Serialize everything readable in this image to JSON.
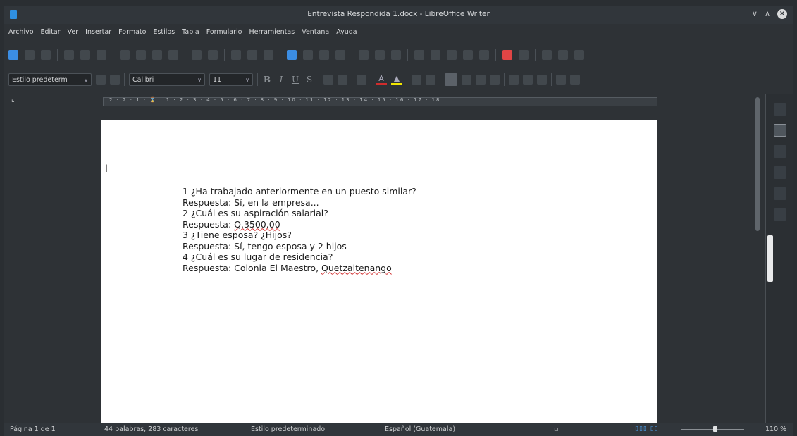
{
  "window": {
    "title": "Entrevista Respondida 1.docx - LibreOffice Writer"
  },
  "menu": [
    "Archivo",
    "Editar",
    "Ver",
    "Insertar",
    "Formato",
    "Estilos",
    "Tabla",
    "Formulario",
    "Herramientas",
    "Ventana",
    "Ayuda"
  ],
  "formatting": {
    "paragraph_style": "Estilo predeterm",
    "font_name": "Calibri",
    "font_size": "11"
  },
  "document": {
    "lines": [
      "1 ¿Ha trabajado anteriormente en un puesto similar?",
      "Respuesta: Sí, en la empresa...",
      "2 ¿Cuál es su aspiración salarial?",
      "Respuesta: Q.3500.00",
      "3 ¿Tiene esposa? ¿Hijos?",
      "Respuesta: Sí, tengo esposa y 2 hijos",
      "4 ¿Cuál es su lugar de residencia?",
      "Respuesta: Colonia El Maestro, Quetzaltenango"
    ]
  },
  "status": {
    "page": "Página 1 de 1",
    "words": "44 palabras, 283 caracteres",
    "style": "Estilo predeterminado",
    "language": "Español (Guatemala)",
    "zoom": "110 %"
  },
  "colors": {
    "font_color_bar": "#d12c2c",
    "highlight_bar": "#f2e600",
    "accent": "#3b8de3"
  }
}
